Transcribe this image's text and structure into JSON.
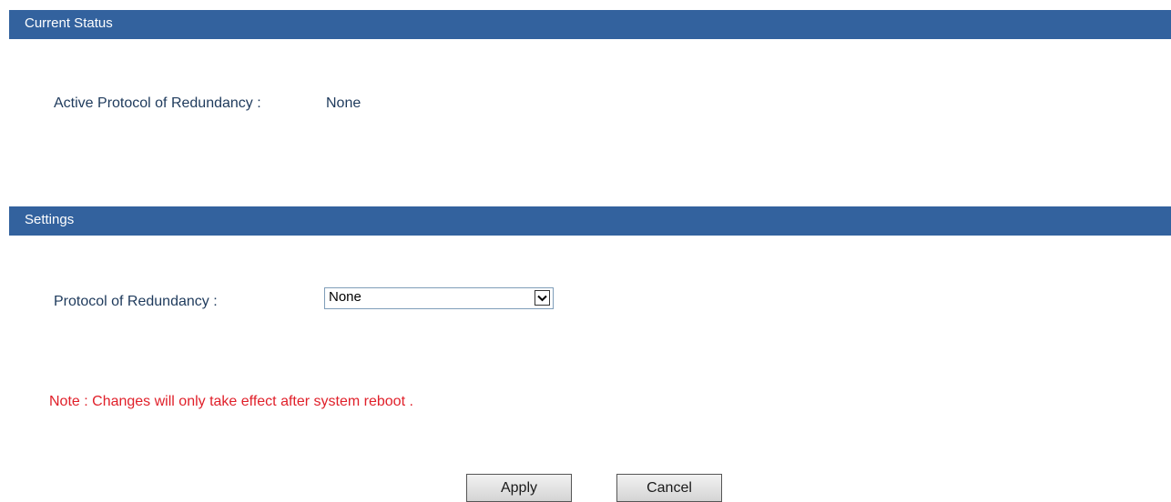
{
  "sections": {
    "current_status": {
      "title": "Current Status",
      "active_protocol_label": "Active Protocol of Redundancy :",
      "active_protocol_value": "None"
    },
    "settings": {
      "title": "Settings",
      "protocol_label": "Protocol of Redundancy :",
      "protocol_selected": "None"
    }
  },
  "note": "Note : Changes will only take effect after system reboot .",
  "buttons": {
    "apply": "Apply",
    "cancel": "Cancel"
  },
  "colors": {
    "header_bg": "#33629e",
    "note_text": "#e0202a",
    "label_text": "#1e3a5c"
  },
  "icons": {
    "dropdown": "chevron-down-icon"
  }
}
